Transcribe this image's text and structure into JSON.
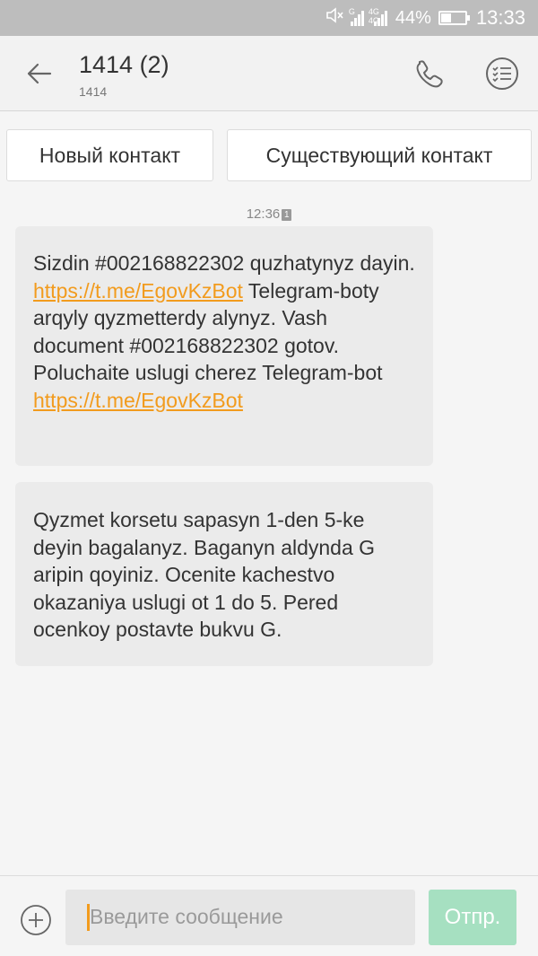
{
  "status_bar": {
    "net_small_1": "G",
    "net_small_2": "4G 4G",
    "battery_percent": "44%",
    "battery_level": 0.44,
    "time": "13:33"
  },
  "header": {
    "title": "1414 (2)",
    "subtitle": "1414"
  },
  "contact_actions": {
    "new_contact": "Новый контакт",
    "existing_contact": "Существующий контакт"
  },
  "messages": {
    "timestamp": "12:36",
    "sim_slot": "1",
    "m1": {
      "t1": "Sizdin #002168822302 quzhatynyz dayin. ",
      "link1": "https://t.me/EgovKzBot",
      "t2": " Telegram-boty arqyly qyzmetterdy alynyz. Vash document #002168822302 gotov. Poluchaite uslugi cherez Telegram-bot ",
      "link2": "https://t.me/EgovKzBot"
    },
    "m2": {
      "text": "Qyzmet korsetu sapasyn 1-den 5-ke deyin bagalanyz. Baganyn aldynda G aripin qoyiniz. Ocenite kachestvo okazaniya uslugi ot 1 do 5. Pered ocenkoy postavte bukvu G."
    }
  },
  "composer": {
    "placeholder": "Введите сообщение",
    "send_label": "Отпр."
  },
  "colors": {
    "link": "#f29b1d",
    "send_button": "#a6e0c1",
    "bubble": "#ebebeb"
  }
}
